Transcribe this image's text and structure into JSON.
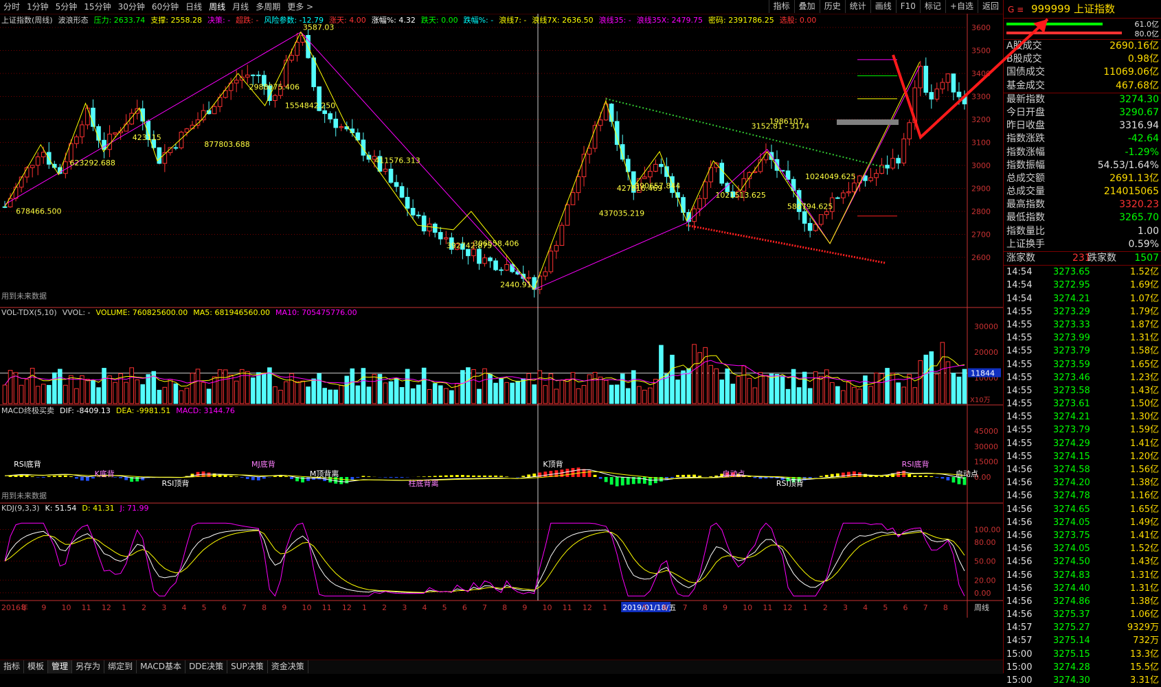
{
  "toolbar": {
    "periods": [
      "分时",
      "1分钟",
      "5分钟",
      "15分钟",
      "30分钟",
      "60分钟",
      "日线",
      "周线",
      "月线",
      "多周期",
      "更多 >"
    ],
    "active_period": "周线",
    "tools": [
      "指标",
      "叠加",
      "历史",
      "统计",
      "画线",
      "F10",
      "标记",
      "+自选",
      "返回"
    ]
  },
  "main_panel": {
    "legend": [
      {
        "text": "上证指数(周线)",
        "color": "#d0d0d0"
      },
      {
        "text": "波浪形态",
        "color": "#d0d0d0"
      },
      {
        "text": "压力: 2633.74",
        "color": "#00ff00"
      },
      {
        "text": "支撑: 2558.28",
        "color": "#ffff00"
      },
      {
        "text": "决策: -",
        "color": "#ff00ff"
      },
      {
        "text": "超跌: -",
        "color": "#ff3333"
      },
      {
        "text": "风险参数: -12.79",
        "color": "#00ffff"
      },
      {
        "text": "涨天: 4.00",
        "color": "#ff3333"
      },
      {
        "text": "涨幅%: 4.32",
        "color": "#ffffff"
      },
      {
        "text": "跌天: 0.00",
        "color": "#00ff00"
      },
      {
        "text": "跌幅%: -",
        "color": "#00ffff"
      },
      {
        "text": "浪线7: -",
        "color": "#ffff00"
      },
      {
        "text": "浪线7X: 2636.50",
        "color": "#ffff00"
      },
      {
        "text": "浪线35: -",
        "color": "#ff00ff"
      },
      {
        "text": "浪线35X: 2479.75",
        "color": "#ff00ff"
      },
      {
        "text": "密码: 2391786.25",
        "color": "#ffff00"
      },
      {
        "text": "选股: 0.00",
        "color": "#ff3333"
      }
    ],
    "y_ticks": [
      "3600",
      "3500",
      "3400",
      "3300",
      "3200",
      "3100",
      "3000",
      "2900",
      "2800",
      "2700",
      "2600"
    ],
    "wave_labels": [
      "3587.03",
      "2988075.406",
      "1554842.250",
      "423115",
      "877803.688",
      "623292.688",
      "678466.500",
      "411576.313",
      "306558.406",
      "392742.875",
      "2440.91",
      "1986107",
      "3152.81 - 3174",
      "1024049.625",
      "586794.625",
      "390657.844",
      "1021513.625",
      "427816.469",
      "437035.219"
    ],
    "note": "用到未来数据"
  },
  "volume_panel": {
    "legend": [
      {
        "text": "VOL-TDX(5,10)",
        "color": "#d0d0d0"
      },
      {
        "text": "VVOL: -",
        "color": "#d0d0d0"
      },
      {
        "text": "VOLUME: 760825600.00",
        "color": "#ffff00"
      },
      {
        "text": "MA5: 681946560.00",
        "color": "#ffff00"
      },
      {
        "text": "MA10: 705475776.00",
        "color": "#ff00ff"
      }
    ],
    "y_ticks": [
      "30000",
      "20000",
      "10000"
    ],
    "current_badge": "11844",
    "unit": "X10万"
  },
  "macd_panel": {
    "legend": [
      {
        "text": "MACD终极买卖",
        "color": "#d0d0d0"
      },
      {
        "text": "DIF: -8409.13",
        "color": "#ffffff"
      },
      {
        "text": "DEA: -9981.51",
        "color": "#ffff00"
      },
      {
        "text": "MACD: 3144.76",
        "color": "#ff00ff"
      }
    ],
    "y_ticks": [
      "45000",
      "30000",
      "15000",
      "0.00"
    ],
    "signals": [
      "RSI底背",
      "K底背",
      "RSI顶背",
      "MJ底背",
      "M顶背离",
      "柱底背离",
      "K顶背",
      "启动点",
      "RSI顶背",
      "RSI底背",
      "启动点"
    ],
    "note": "用到未来数据"
  },
  "kdj_panel": {
    "legend": [
      {
        "text": "KDJ(9,3,3)",
        "color": "#d0d0d0"
      },
      {
        "text": "K: 51.54",
        "color": "#ffffff"
      },
      {
        "text": "D: 41.31",
        "color": "#ffff00"
      },
      {
        "text": "J: 71.99",
        "color": "#ff00ff"
      }
    ],
    "y_ticks": [
      "100.00",
      "80.00",
      "50.00",
      "20.00",
      "0.00"
    ]
  },
  "x_axis": {
    "labels": [
      "2016年",
      "8",
      "9",
      "10",
      "11",
      "12",
      "1",
      "2",
      "3",
      "4",
      "5",
      "6",
      "7",
      "8",
      "9",
      "10",
      "11",
      "12",
      "1",
      "2",
      "3",
      "4",
      "5",
      "6",
      "7",
      "8",
      "9",
      "10",
      "11",
      "12",
      "1",
      "2019/01/18/五",
      "5",
      "6",
      "7",
      "8",
      "9",
      "10",
      "11",
      "12",
      "1",
      "2",
      "3",
      "4",
      "5",
      "6",
      "7",
      "8"
    ],
    "period": "周线"
  },
  "bottom_tabs": [
    "指标",
    "模板",
    "管理",
    "另存为",
    "绑定到",
    "MACD基本",
    "DDE决策",
    "SUP决策",
    "资金决策"
  ],
  "active_bottom_tab": "管理",
  "quote_panel": {
    "code": "999999",
    "name": "上证指数",
    "bar_values": [
      "61.0亿",
      "80.0亿"
    ],
    "stats": [
      {
        "label": "A股成交",
        "value": "2690.16亿",
        "color": "#ffdd00"
      },
      {
        "label": "B股成交",
        "value": "0.98亿",
        "color": "#ffdd00"
      },
      {
        "label": "国债成交",
        "value": "11069.06亿",
        "color": "#ffdd00"
      },
      {
        "label": "基金成交",
        "value": "467.68亿",
        "color": "#ffdd00"
      },
      {
        "label": "最新指数",
        "value": "3274.30",
        "color": "#00ff00"
      },
      {
        "label": "今日开盘",
        "value": "3290.67",
        "color": "#00ff00"
      },
      {
        "label": "昨日收盘",
        "value": "3316.94",
        "color": "#e0e0e0"
      },
      {
        "label": "指数涨跌",
        "value": "-42.64",
        "color": "#00ff00"
      },
      {
        "label": "指数涨幅",
        "value": "-1.29%",
        "color": "#00ff00"
      },
      {
        "label": "指数振幅",
        "value": "54.53/1.64%",
        "color": "#e0e0e0"
      },
      {
        "label": "总成交额",
        "value": "2691.13亿",
        "color": "#ffdd00"
      },
      {
        "label": "总成交量",
        "value": "214015065",
        "color": "#ffdd00"
      },
      {
        "label": "最高指数",
        "value": "3320.23",
        "color": "#ff3333"
      },
      {
        "label": "最低指数",
        "value": "3265.70",
        "color": "#00ff00"
      },
      {
        "label": "指数量比",
        "value": "1.00",
        "color": "#e0e0e0"
      },
      {
        "label": "上证换手",
        "value": "0.59%",
        "color": "#e0e0e0"
      }
    ],
    "breadth": {
      "up_label": "涨家数",
      "up": "231",
      "down_label": "跌家数",
      "down": "1507"
    },
    "ticks": [
      {
        "time": "14:54",
        "price": "3273.65",
        "vol": "1.52亿"
      },
      {
        "time": "14:54",
        "price": "3272.95",
        "vol": "1.69亿"
      },
      {
        "time": "14:54",
        "price": "3274.21",
        "vol": "1.07亿"
      },
      {
        "time": "14:55",
        "price": "3273.29",
        "vol": "1.79亿"
      },
      {
        "time": "14:55",
        "price": "3273.33",
        "vol": "1.87亿"
      },
      {
        "time": "14:55",
        "price": "3273.99",
        "vol": "1.31亿"
      },
      {
        "time": "14:55",
        "price": "3273.79",
        "vol": "1.58亿"
      },
      {
        "time": "14:55",
        "price": "3273.59",
        "vol": "1.65亿"
      },
      {
        "time": "14:55",
        "price": "3273.46",
        "vol": "1.23亿"
      },
      {
        "time": "14:55",
        "price": "3273.58",
        "vol": "1.43亿"
      },
      {
        "time": "14:55",
        "price": "3273.61",
        "vol": "1.50亿"
      },
      {
        "time": "14:55",
        "price": "3274.21",
        "vol": "1.30亿"
      },
      {
        "time": "14:55",
        "price": "3273.79",
        "vol": "1.59亿"
      },
      {
        "time": "14:55",
        "price": "3274.29",
        "vol": "1.41亿"
      },
      {
        "time": "14:55",
        "price": "3274.15",
        "vol": "1.20亿"
      },
      {
        "time": "14:56",
        "price": "3274.58",
        "vol": "1.56亿"
      },
      {
        "time": "14:56",
        "price": "3274.20",
        "vol": "1.38亿"
      },
      {
        "time": "14:56",
        "price": "3274.78",
        "vol": "1.16亿"
      },
      {
        "time": "14:56",
        "price": "3274.65",
        "vol": "1.65亿"
      },
      {
        "time": "14:56",
        "price": "3274.05",
        "vol": "1.49亿"
      },
      {
        "time": "14:56",
        "price": "3273.75",
        "vol": "1.41亿"
      },
      {
        "time": "14:56",
        "price": "3274.05",
        "vol": "1.52亿"
      },
      {
        "time": "14:56",
        "price": "3274.50",
        "vol": "1.43亿"
      },
      {
        "time": "14:56",
        "price": "3274.83",
        "vol": "1.31亿"
      },
      {
        "time": "14:56",
        "price": "3274.40",
        "vol": "1.31亿"
      },
      {
        "time": "14:56",
        "price": "3274.86",
        "vol": "1.38亿"
      },
      {
        "time": "14:56",
        "price": "3275.37",
        "vol": "1.06亿"
      },
      {
        "time": "14:57",
        "price": "3275.27",
        "vol": "9329万"
      },
      {
        "time": "14:57",
        "price": "3275.14",
        "vol": "732万"
      },
      {
        "time": "15:00",
        "price": "3275.15",
        "vol": "13.3亿"
      },
      {
        "time": "15:00",
        "price": "3274.28",
        "vol": "15.5亿"
      },
      {
        "time": "15:00",
        "price": "3274.30",
        "vol": "3.31亿"
      }
    ]
  },
  "colors": {
    "up": "#ff3232",
    "down": "#54fcfc",
    "grid": "#7a0000",
    "axis": "#c83232",
    "yellow": "#ffff00",
    "magenta": "#ff00ff",
    "green": "#00ff00"
  }
}
